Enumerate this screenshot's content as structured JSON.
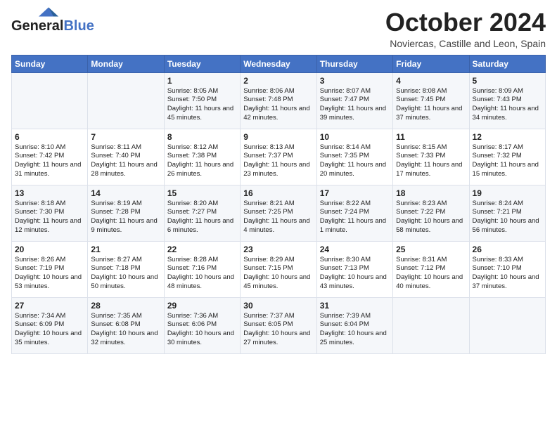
{
  "header": {
    "logo_line1": "General",
    "logo_line2": "Blue",
    "month": "October 2024",
    "location": "Noviercas, Castille and Leon, Spain"
  },
  "weekdays": [
    "Sunday",
    "Monday",
    "Tuesday",
    "Wednesday",
    "Thursday",
    "Friday",
    "Saturday"
  ],
  "weeks": [
    [
      {
        "day": "",
        "info": ""
      },
      {
        "day": "",
        "info": ""
      },
      {
        "day": "1",
        "info": "Sunrise: 8:05 AM\nSunset: 7:50 PM\nDaylight: 11 hours and 45 minutes."
      },
      {
        "day": "2",
        "info": "Sunrise: 8:06 AM\nSunset: 7:48 PM\nDaylight: 11 hours and 42 minutes."
      },
      {
        "day": "3",
        "info": "Sunrise: 8:07 AM\nSunset: 7:47 PM\nDaylight: 11 hours and 39 minutes."
      },
      {
        "day": "4",
        "info": "Sunrise: 8:08 AM\nSunset: 7:45 PM\nDaylight: 11 hours and 37 minutes."
      },
      {
        "day": "5",
        "info": "Sunrise: 8:09 AM\nSunset: 7:43 PM\nDaylight: 11 hours and 34 minutes."
      }
    ],
    [
      {
        "day": "6",
        "info": "Sunrise: 8:10 AM\nSunset: 7:42 PM\nDaylight: 11 hours and 31 minutes."
      },
      {
        "day": "7",
        "info": "Sunrise: 8:11 AM\nSunset: 7:40 PM\nDaylight: 11 hours and 28 minutes."
      },
      {
        "day": "8",
        "info": "Sunrise: 8:12 AM\nSunset: 7:38 PM\nDaylight: 11 hours and 26 minutes."
      },
      {
        "day": "9",
        "info": "Sunrise: 8:13 AM\nSunset: 7:37 PM\nDaylight: 11 hours and 23 minutes."
      },
      {
        "day": "10",
        "info": "Sunrise: 8:14 AM\nSunset: 7:35 PM\nDaylight: 11 hours and 20 minutes."
      },
      {
        "day": "11",
        "info": "Sunrise: 8:15 AM\nSunset: 7:33 PM\nDaylight: 11 hours and 17 minutes."
      },
      {
        "day": "12",
        "info": "Sunrise: 8:17 AM\nSunset: 7:32 PM\nDaylight: 11 hours and 15 minutes."
      }
    ],
    [
      {
        "day": "13",
        "info": "Sunrise: 8:18 AM\nSunset: 7:30 PM\nDaylight: 11 hours and 12 minutes."
      },
      {
        "day": "14",
        "info": "Sunrise: 8:19 AM\nSunset: 7:28 PM\nDaylight: 11 hours and 9 minutes."
      },
      {
        "day": "15",
        "info": "Sunrise: 8:20 AM\nSunset: 7:27 PM\nDaylight: 11 hours and 6 minutes."
      },
      {
        "day": "16",
        "info": "Sunrise: 8:21 AM\nSunset: 7:25 PM\nDaylight: 11 hours and 4 minutes."
      },
      {
        "day": "17",
        "info": "Sunrise: 8:22 AM\nSunset: 7:24 PM\nDaylight: 11 hours and 1 minute."
      },
      {
        "day": "18",
        "info": "Sunrise: 8:23 AM\nSunset: 7:22 PM\nDaylight: 10 hours and 58 minutes."
      },
      {
        "day": "19",
        "info": "Sunrise: 8:24 AM\nSunset: 7:21 PM\nDaylight: 10 hours and 56 minutes."
      }
    ],
    [
      {
        "day": "20",
        "info": "Sunrise: 8:26 AM\nSunset: 7:19 PM\nDaylight: 10 hours and 53 minutes."
      },
      {
        "day": "21",
        "info": "Sunrise: 8:27 AM\nSunset: 7:18 PM\nDaylight: 10 hours and 50 minutes."
      },
      {
        "day": "22",
        "info": "Sunrise: 8:28 AM\nSunset: 7:16 PM\nDaylight: 10 hours and 48 minutes."
      },
      {
        "day": "23",
        "info": "Sunrise: 8:29 AM\nSunset: 7:15 PM\nDaylight: 10 hours and 45 minutes."
      },
      {
        "day": "24",
        "info": "Sunrise: 8:30 AM\nSunset: 7:13 PM\nDaylight: 10 hours and 43 minutes."
      },
      {
        "day": "25",
        "info": "Sunrise: 8:31 AM\nSunset: 7:12 PM\nDaylight: 10 hours and 40 minutes."
      },
      {
        "day": "26",
        "info": "Sunrise: 8:33 AM\nSunset: 7:10 PM\nDaylight: 10 hours and 37 minutes."
      }
    ],
    [
      {
        "day": "27",
        "info": "Sunrise: 7:34 AM\nSunset: 6:09 PM\nDaylight: 10 hours and 35 minutes."
      },
      {
        "day": "28",
        "info": "Sunrise: 7:35 AM\nSunset: 6:08 PM\nDaylight: 10 hours and 32 minutes."
      },
      {
        "day": "29",
        "info": "Sunrise: 7:36 AM\nSunset: 6:06 PM\nDaylight: 10 hours and 30 minutes."
      },
      {
        "day": "30",
        "info": "Sunrise: 7:37 AM\nSunset: 6:05 PM\nDaylight: 10 hours and 27 minutes."
      },
      {
        "day": "31",
        "info": "Sunrise: 7:39 AM\nSunset: 6:04 PM\nDaylight: 10 hours and 25 minutes."
      },
      {
        "day": "",
        "info": ""
      },
      {
        "day": "",
        "info": ""
      }
    ]
  ]
}
